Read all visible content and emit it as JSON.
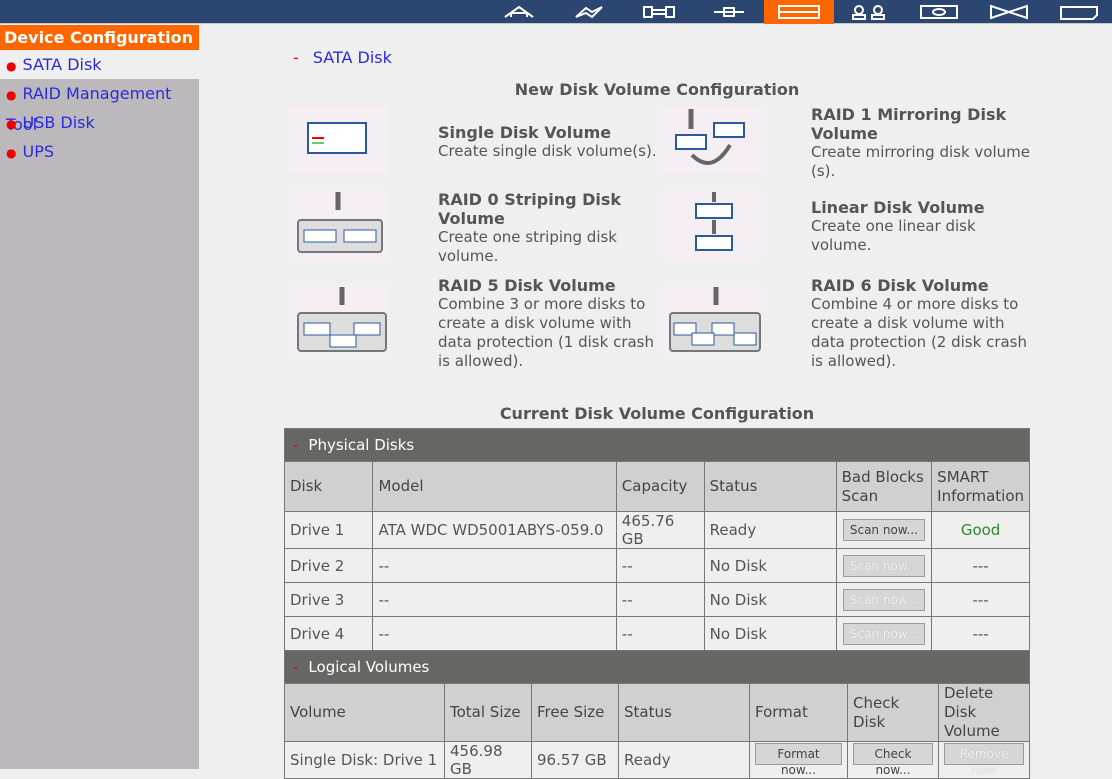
{
  "topbar": {
    "icons": [
      "home-icon",
      "network-icon",
      "system-tools-icon",
      "device-icon",
      "device-configuration-icon",
      "users-icon",
      "shares-icon",
      "network-services-icon",
      "status-icon"
    ],
    "active_index": 4,
    "accent": "#ff6600",
    "bg": "#2c4672"
  },
  "sidebar": {
    "title": "Device Configuration",
    "items": [
      {
        "label": "SATA Disk",
        "selected": true
      },
      {
        "label": "RAID Management Tool"
      },
      {
        "label": "USB Disk"
      },
      {
        "label": "UPS"
      }
    ]
  },
  "section": {
    "label": "SATA Disk"
  },
  "new_config": {
    "title": "New Disk Volume Configuration",
    "options": [
      {
        "title": "Single Disk Volume",
        "desc": "Create single disk volume(s)."
      },
      {
        "title": "RAID 1 Mirroring Disk Volume",
        "desc": "Create mirroring disk volume (s)."
      },
      {
        "title": "RAID 0 Striping Disk Volume",
        "desc": "Create one striping disk volume."
      },
      {
        "title": "Linear Disk Volume",
        "desc": "Create one linear disk volume."
      },
      {
        "title": "RAID 5 Disk Volume",
        "desc": "Combine 3 or more disks to create a disk volume with data protection (1 disk crash is allowed)."
      },
      {
        "title": "RAID 6 Disk Volume",
        "desc": "Combine 4 or more disks to create a disk volume with data protection (2 disk crash is allowed)."
      }
    ]
  },
  "current_config": {
    "title": "Current Disk Volume Configuration"
  },
  "physical": {
    "title": "Physical Disks",
    "headers": [
      "Disk",
      "Model",
      "Capacity",
      "Status",
      "Bad Blocks Scan",
      "SMART Information"
    ],
    "rows": [
      {
        "disk": "Drive 1",
        "model": "ATA WDC WD5001ABYS-059.0",
        "capacity": "465.76 GB",
        "status": "Ready",
        "scan": "Scan now...",
        "smart": "Good"
      },
      {
        "disk": "Drive 2",
        "model": "--",
        "capacity": "--",
        "status": "No Disk",
        "scan": "Scan now...",
        "smart": "---"
      },
      {
        "disk": "Drive 3",
        "model": "--",
        "capacity": "--",
        "status": "No Disk",
        "scan": "Scan now...",
        "smart": "---"
      },
      {
        "disk": "Drive 4",
        "model": "--",
        "capacity": "--",
        "status": "No Disk",
        "scan": "Scan now...",
        "smart": "---"
      }
    ]
  },
  "logical": {
    "title": "Logical Volumes",
    "headers": [
      "Volume",
      "Total Size",
      "Free Size",
      "Status",
      "Format",
      "Check Disk",
      "Delete Disk Volume"
    ],
    "rows": [
      {
        "volume": "Single Disk: Drive 1",
        "total": "456.98 GB",
        "free": "96.57 GB",
        "status": "Ready",
        "format": "Format now...",
        "check": "Check now...",
        "remove": "Remove now"
      }
    ]
  }
}
